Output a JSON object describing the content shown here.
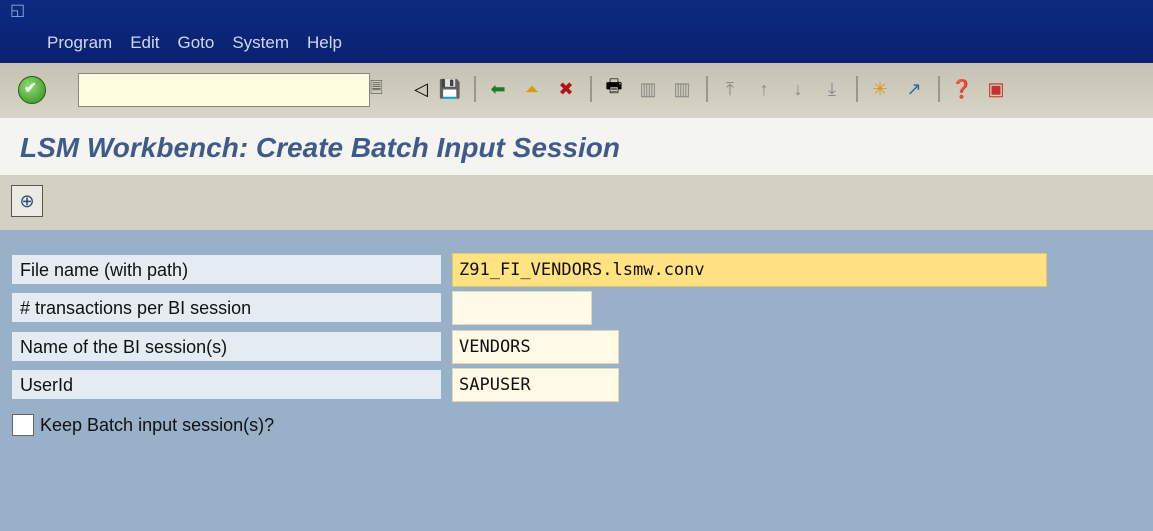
{
  "menu": [
    "Program",
    "Edit",
    "Goto",
    "System",
    "Help"
  ],
  "command_field": {
    "value": ""
  },
  "title": "LSM Workbench: Create Batch Input Session",
  "form": {
    "file_name": {
      "label": "File name (with path)",
      "value": "Z91_FI_VENDORS.lsmw.conv"
    },
    "transactions": {
      "label": "# transactions per BI session",
      "value": ""
    },
    "session_name": {
      "label": "Name of the BI session(s)",
      "value": "VENDORS"
    },
    "userid": {
      "label": "UserId",
      "value": "SAPUSER"
    },
    "keep": {
      "label": "Keep Batch input session(s)?",
      "checked": false
    }
  },
  "colors": {
    "menubar": "#0a2170",
    "title": "#3f5b8a",
    "required_field": "#ffe282",
    "form_bg": "#98b0c8"
  },
  "icons": [
    "enter-icon",
    "command-field-button-icon",
    "back-arrow-icon",
    "save-icon",
    "back-icon",
    "exit-icon",
    "cancel-icon",
    "print-icon",
    "find-icon",
    "find-next-icon",
    "first-page-icon",
    "previous-page-icon",
    "next-page-icon",
    "last-page-icon",
    "create-session-icon",
    "generate-shortcut-icon",
    "help-icon",
    "customize-layout-icon",
    "execute-icon"
  ]
}
